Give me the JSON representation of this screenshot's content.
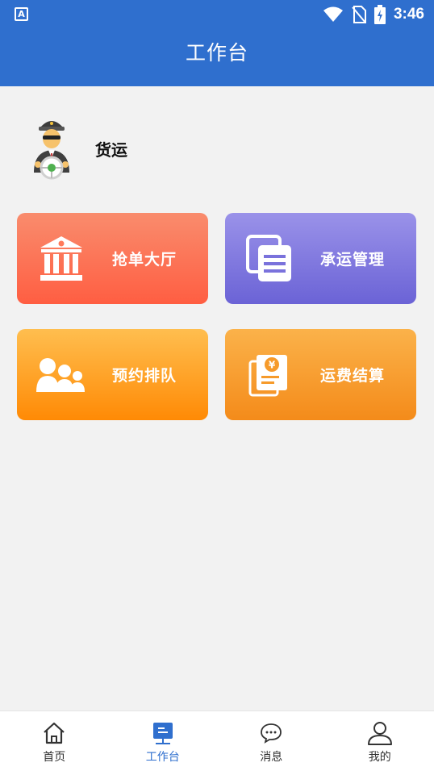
{
  "status_bar": {
    "app_icon_letter": "A",
    "time": "3:46",
    "icons": [
      "wifi-icon",
      "no-sim-icon",
      "battery-charging-icon"
    ]
  },
  "app_bar": {
    "title": "工作台"
  },
  "profile": {
    "name": "货运",
    "avatar_icon": "driver-avatar-icon"
  },
  "cards": [
    {
      "label": "抢单大厅",
      "icon": "bank-building-icon",
      "color": "#ff6a4d"
    },
    {
      "label": "承运管理",
      "icon": "documents-icon",
      "color": "#776fdc"
    },
    {
      "label": "预约排队",
      "icon": "queue-people-icon",
      "color": "#ff9a1a"
    },
    {
      "label": "运费结算",
      "icon": "yuan-bill-icon",
      "color": "#f69a2a"
    }
  ],
  "tab_bar": {
    "active": "工作台",
    "accent": "#2f6fce",
    "items": [
      {
        "label": "首页",
        "icon": "home-icon"
      },
      {
        "label": "工作台",
        "icon": "workbench-icon"
      },
      {
        "label": "消息",
        "icon": "message-bubble-icon"
      },
      {
        "label": "我的",
        "icon": "user-icon"
      }
    ]
  }
}
